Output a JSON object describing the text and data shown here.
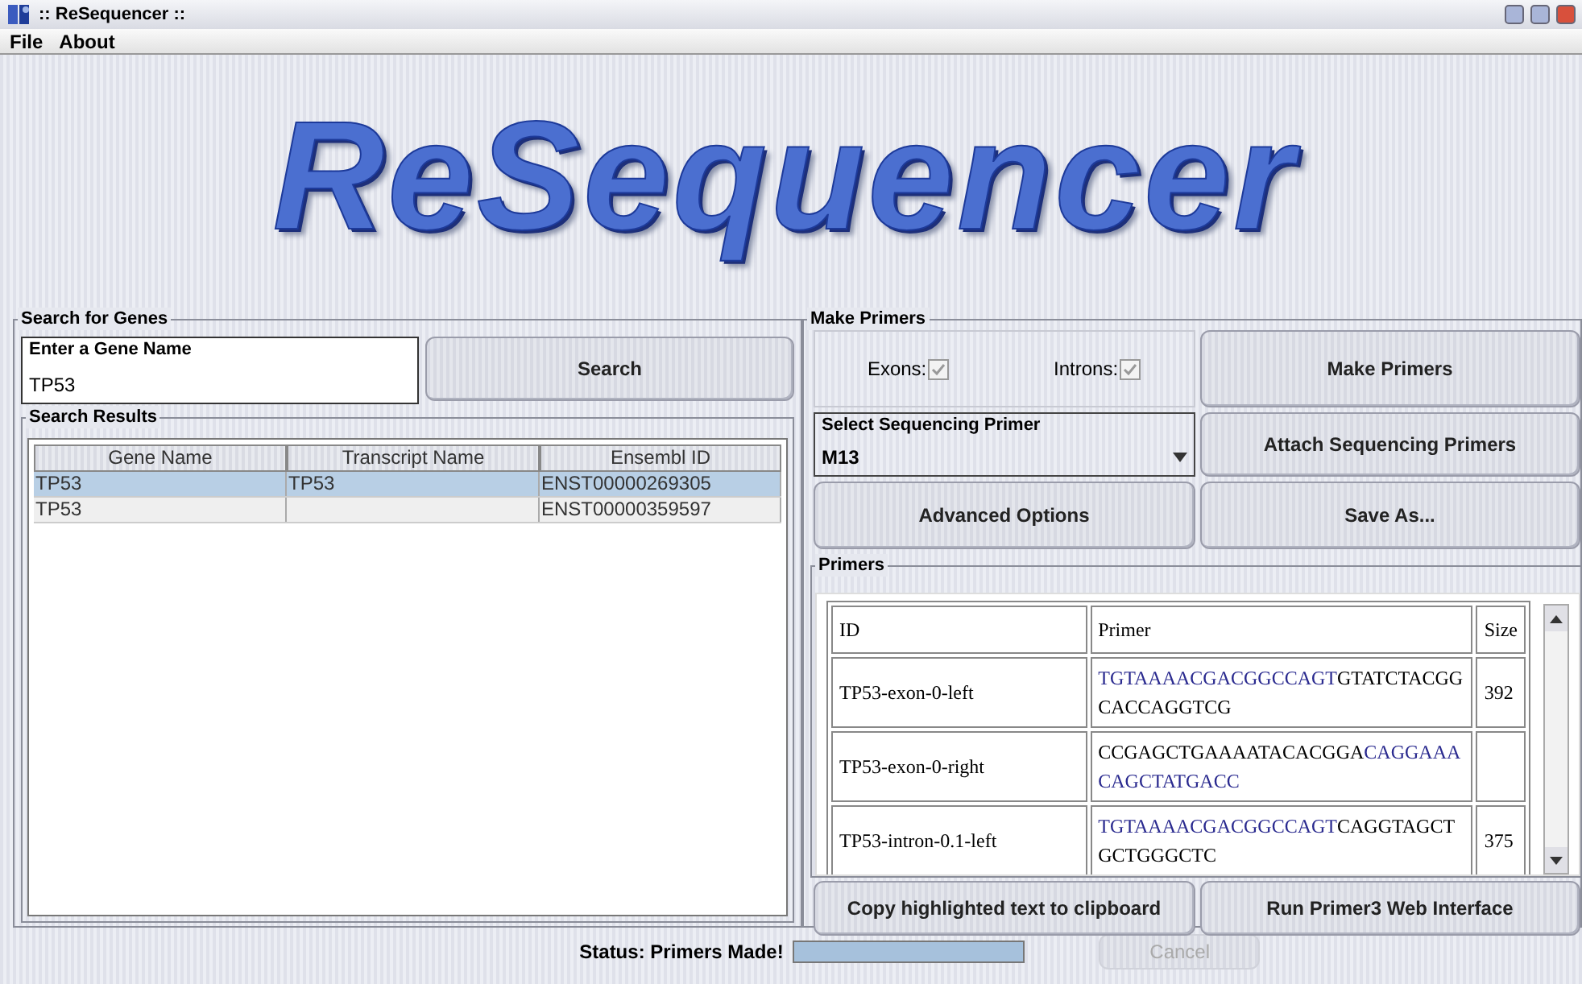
{
  "window": {
    "title": ":: ReSequencer ::"
  },
  "menu": [
    "File",
    "About"
  ],
  "banner": {
    "logo": "ReSequencer"
  },
  "search_panel": {
    "title": "Search for Genes",
    "gene_field": {
      "label": "Enter a Gene Name",
      "value": "TP53"
    },
    "search_button": "Search",
    "results": {
      "title": "Search Results",
      "columns": [
        "Gene Name",
        "Transcript Name",
        "Ensembl ID"
      ],
      "rows": [
        {
          "cells": [
            "TP53",
            "TP53",
            "ENST00000269305"
          ],
          "selected": true
        },
        {
          "cells": [
            "TP53",
            "",
            "ENST00000359597"
          ],
          "selected": false
        }
      ]
    }
  },
  "primers_panel": {
    "title": "Make Primers",
    "options": [
      {
        "label": "Exons:",
        "checked": true
      },
      {
        "label": "Introns:",
        "checked": true
      }
    ],
    "make_button": "Make Primers",
    "sequencing_primer": {
      "label": "Select Sequencing Primer",
      "value": "M13"
    },
    "attach_button": "Attach Sequencing Primers",
    "advanced_button": "Advanced Options",
    "save_button": "Save As...",
    "primers": {
      "title": "Primers",
      "columns": [
        "ID",
        "Primer",
        "Size"
      ],
      "rows": [
        {
          "id": "TP53-exon-0-left",
          "primer": [
            {
              "text": "TGTAAAACGACGGCCAGT",
              "kind": "tag"
            },
            {
              "text": "GTATCTACGGCACCAGGTCG",
              "kind": "gene"
            }
          ],
          "size": "392"
        },
        {
          "id": "TP53-exon-0-right",
          "primer": [
            {
              "text": "CCGAGCTGAAAATACACGGA",
              "kind": "gene"
            },
            {
              "text": "CAGGAAACAGCTATGACC",
              "kind": "tag"
            }
          ],
          "size": ""
        },
        {
          "id": "TP53-intron-0.1-left",
          "primer": [
            {
              "text": "TGTAAAACGACGGCCAGT",
              "kind": "tag"
            },
            {
              "text": "CAGGTAGCTGCTGGGCTC",
              "kind": "gene"
            }
          ],
          "size": "375"
        }
      ]
    },
    "copy_button": "Copy highlighted text to clipboard",
    "primer3_button": "Run Primer3 Web Interface"
  },
  "status_bar": {
    "text": "Status: Primers Made!",
    "progress": {
      "level": 1.0
    },
    "cancel_button": {
      "label": "Cancel",
      "disabled": true
    }
  }
}
